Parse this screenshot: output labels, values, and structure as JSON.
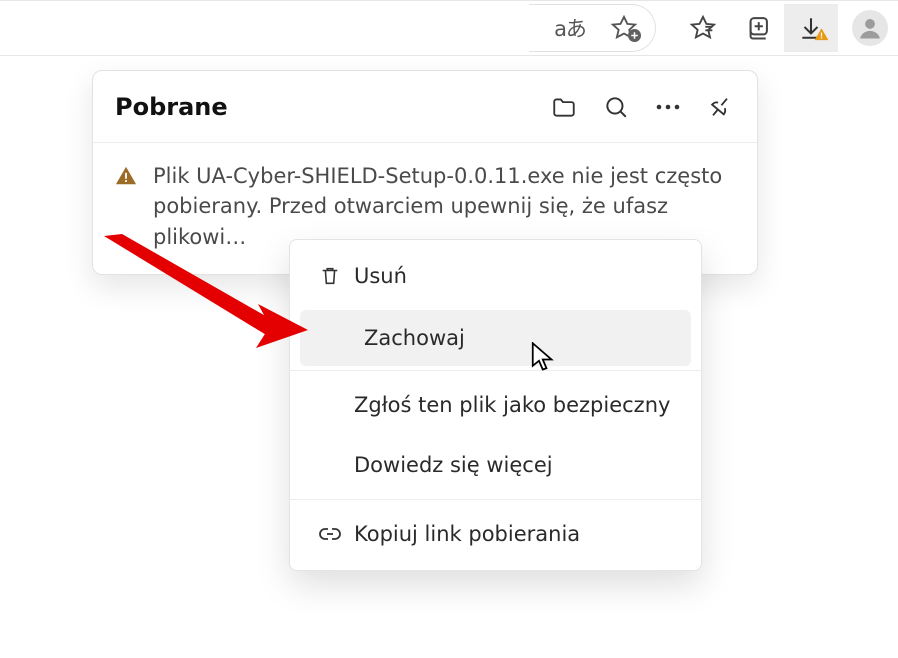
{
  "toolbar": {
    "translate_glyph": "aあ"
  },
  "panel": {
    "title": "Pobrane",
    "item_text": "Plik UA-Cyber-SHIELD-Setup-0.0.11.exe nie jest często pobierany. Przed otwarciem upewnij się, że ufasz plikowi…"
  },
  "context_menu": {
    "delete": "Usuń",
    "keep": "Zachowaj",
    "report_safe": "Zgłoś ten plik jako bezpieczny",
    "learn_more": "Dowiedz się więcej",
    "copy_link": "Kopiuj link pobierania"
  }
}
